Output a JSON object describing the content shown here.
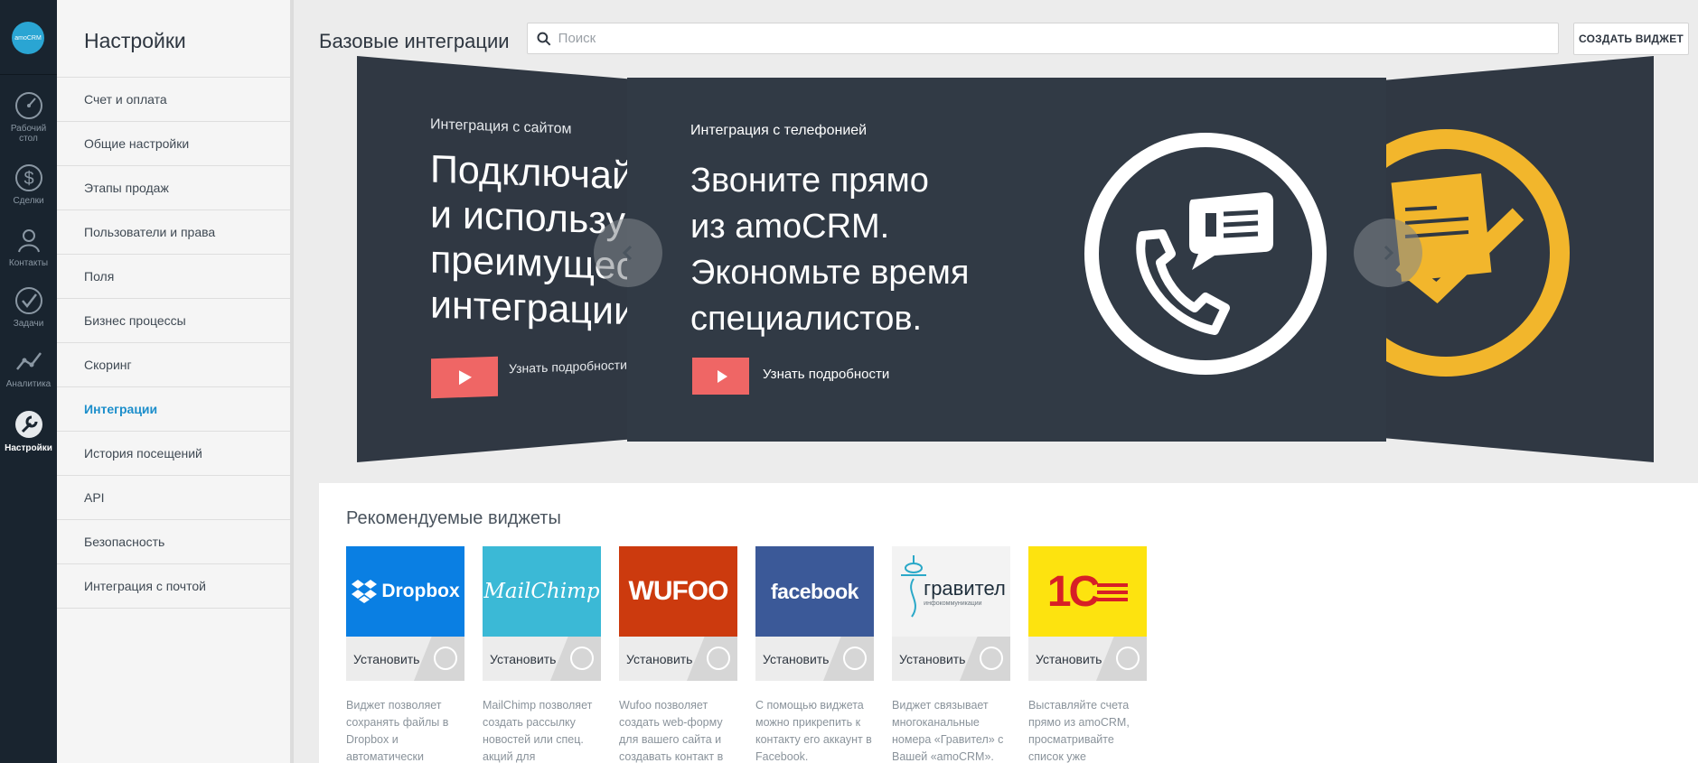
{
  "rail": {
    "logo": "amoCRM",
    "items": [
      {
        "label": "Рабочий стол",
        "icon": "dashboard-icon"
      },
      {
        "label": "Сделки",
        "icon": "dollar-icon"
      },
      {
        "label": "Контакты",
        "icon": "contacts-icon"
      },
      {
        "label": "Задачи",
        "icon": "tasks-check-icon"
      },
      {
        "label": "Аналитика",
        "icon": "analytics-icon"
      },
      {
        "label": "Настройки",
        "icon": "wrench-icon"
      }
    ]
  },
  "menu": {
    "title": "Настройки",
    "items": [
      {
        "label": "Счет и оплата"
      },
      {
        "label": "Общие настройки"
      },
      {
        "label": "Этапы продаж"
      },
      {
        "label": "Пользователи и права"
      },
      {
        "label": "Поля"
      },
      {
        "label": "Бизнес процессы"
      },
      {
        "label": "Скоринг"
      },
      {
        "label": "Интеграции"
      },
      {
        "label": "История посещений"
      },
      {
        "label": "API"
      },
      {
        "label": "Безопасность"
      },
      {
        "label": "Интеграция с почтой"
      }
    ],
    "active_index": 7
  },
  "header": {
    "title": "Базовые интеграции",
    "search_placeholder": "Поиск",
    "create_label": "СОЗДАТЬ ВИДЖЕТ"
  },
  "carousel": {
    "left": {
      "subtitle": "Интеграция с сайтом",
      "headline": [
        "Подключай",
        "и используй",
        "преимущес",
        "интеграции"
      ],
      "more_label": "Узнать подробности"
    },
    "center": {
      "subtitle": "Интеграция с телефонией",
      "headline": [
        "Звоните прямо",
        "из amoCRM.",
        "Экономьте время",
        "специалистов."
      ],
      "more_label": "Узнать подробности"
    }
  },
  "widgets": {
    "title": "Рекомендуемые виджеты",
    "items": [
      {
        "name": "Dropbox",
        "install_label": "Установить",
        "bg": "#0a7fe3",
        "desc": [
          "Виджет позволяет",
          "сохранять файлы в",
          "Dropbox и",
          "автоматически"
        ]
      },
      {
        "name": "MailChimp",
        "install_label": "Установить",
        "bg": "#3bb9d6",
        "desc": [
          "MailChimp позволяет",
          "создать рассылку",
          "новостей или спец.",
          "акций для"
        ]
      },
      {
        "name": "WUFOO",
        "install_label": "Установить",
        "bg": "#cc3a0e",
        "desc": [
          "Wufoo позволяет",
          "создать web-форму",
          "для вашего сайта и",
          "создавать контакт в"
        ]
      },
      {
        "name": "facebook",
        "install_label": "Установить",
        "bg": "#3b5998",
        "desc": [
          "С помощью виджета",
          "можно прикрепить к",
          "контакту его аккаунт в",
          "Facebook."
        ]
      },
      {
        "name": "гравител",
        "tagline": "инфокоммуникации",
        "install_label": "Установить",
        "bg": "#f3f3f3",
        "desc": [
          "Виджет связывает",
          "многоканальные",
          "номера «Гравител» с",
          "Вашей «amoCRM»."
        ]
      },
      {
        "name": "1С",
        "install_label": "Установить",
        "bg": "#fde30f",
        "desc": [
          "Выставляйте счета",
          "прямо из amoCRM,",
          "просматривайте",
          "список уже"
        ]
      }
    ]
  }
}
